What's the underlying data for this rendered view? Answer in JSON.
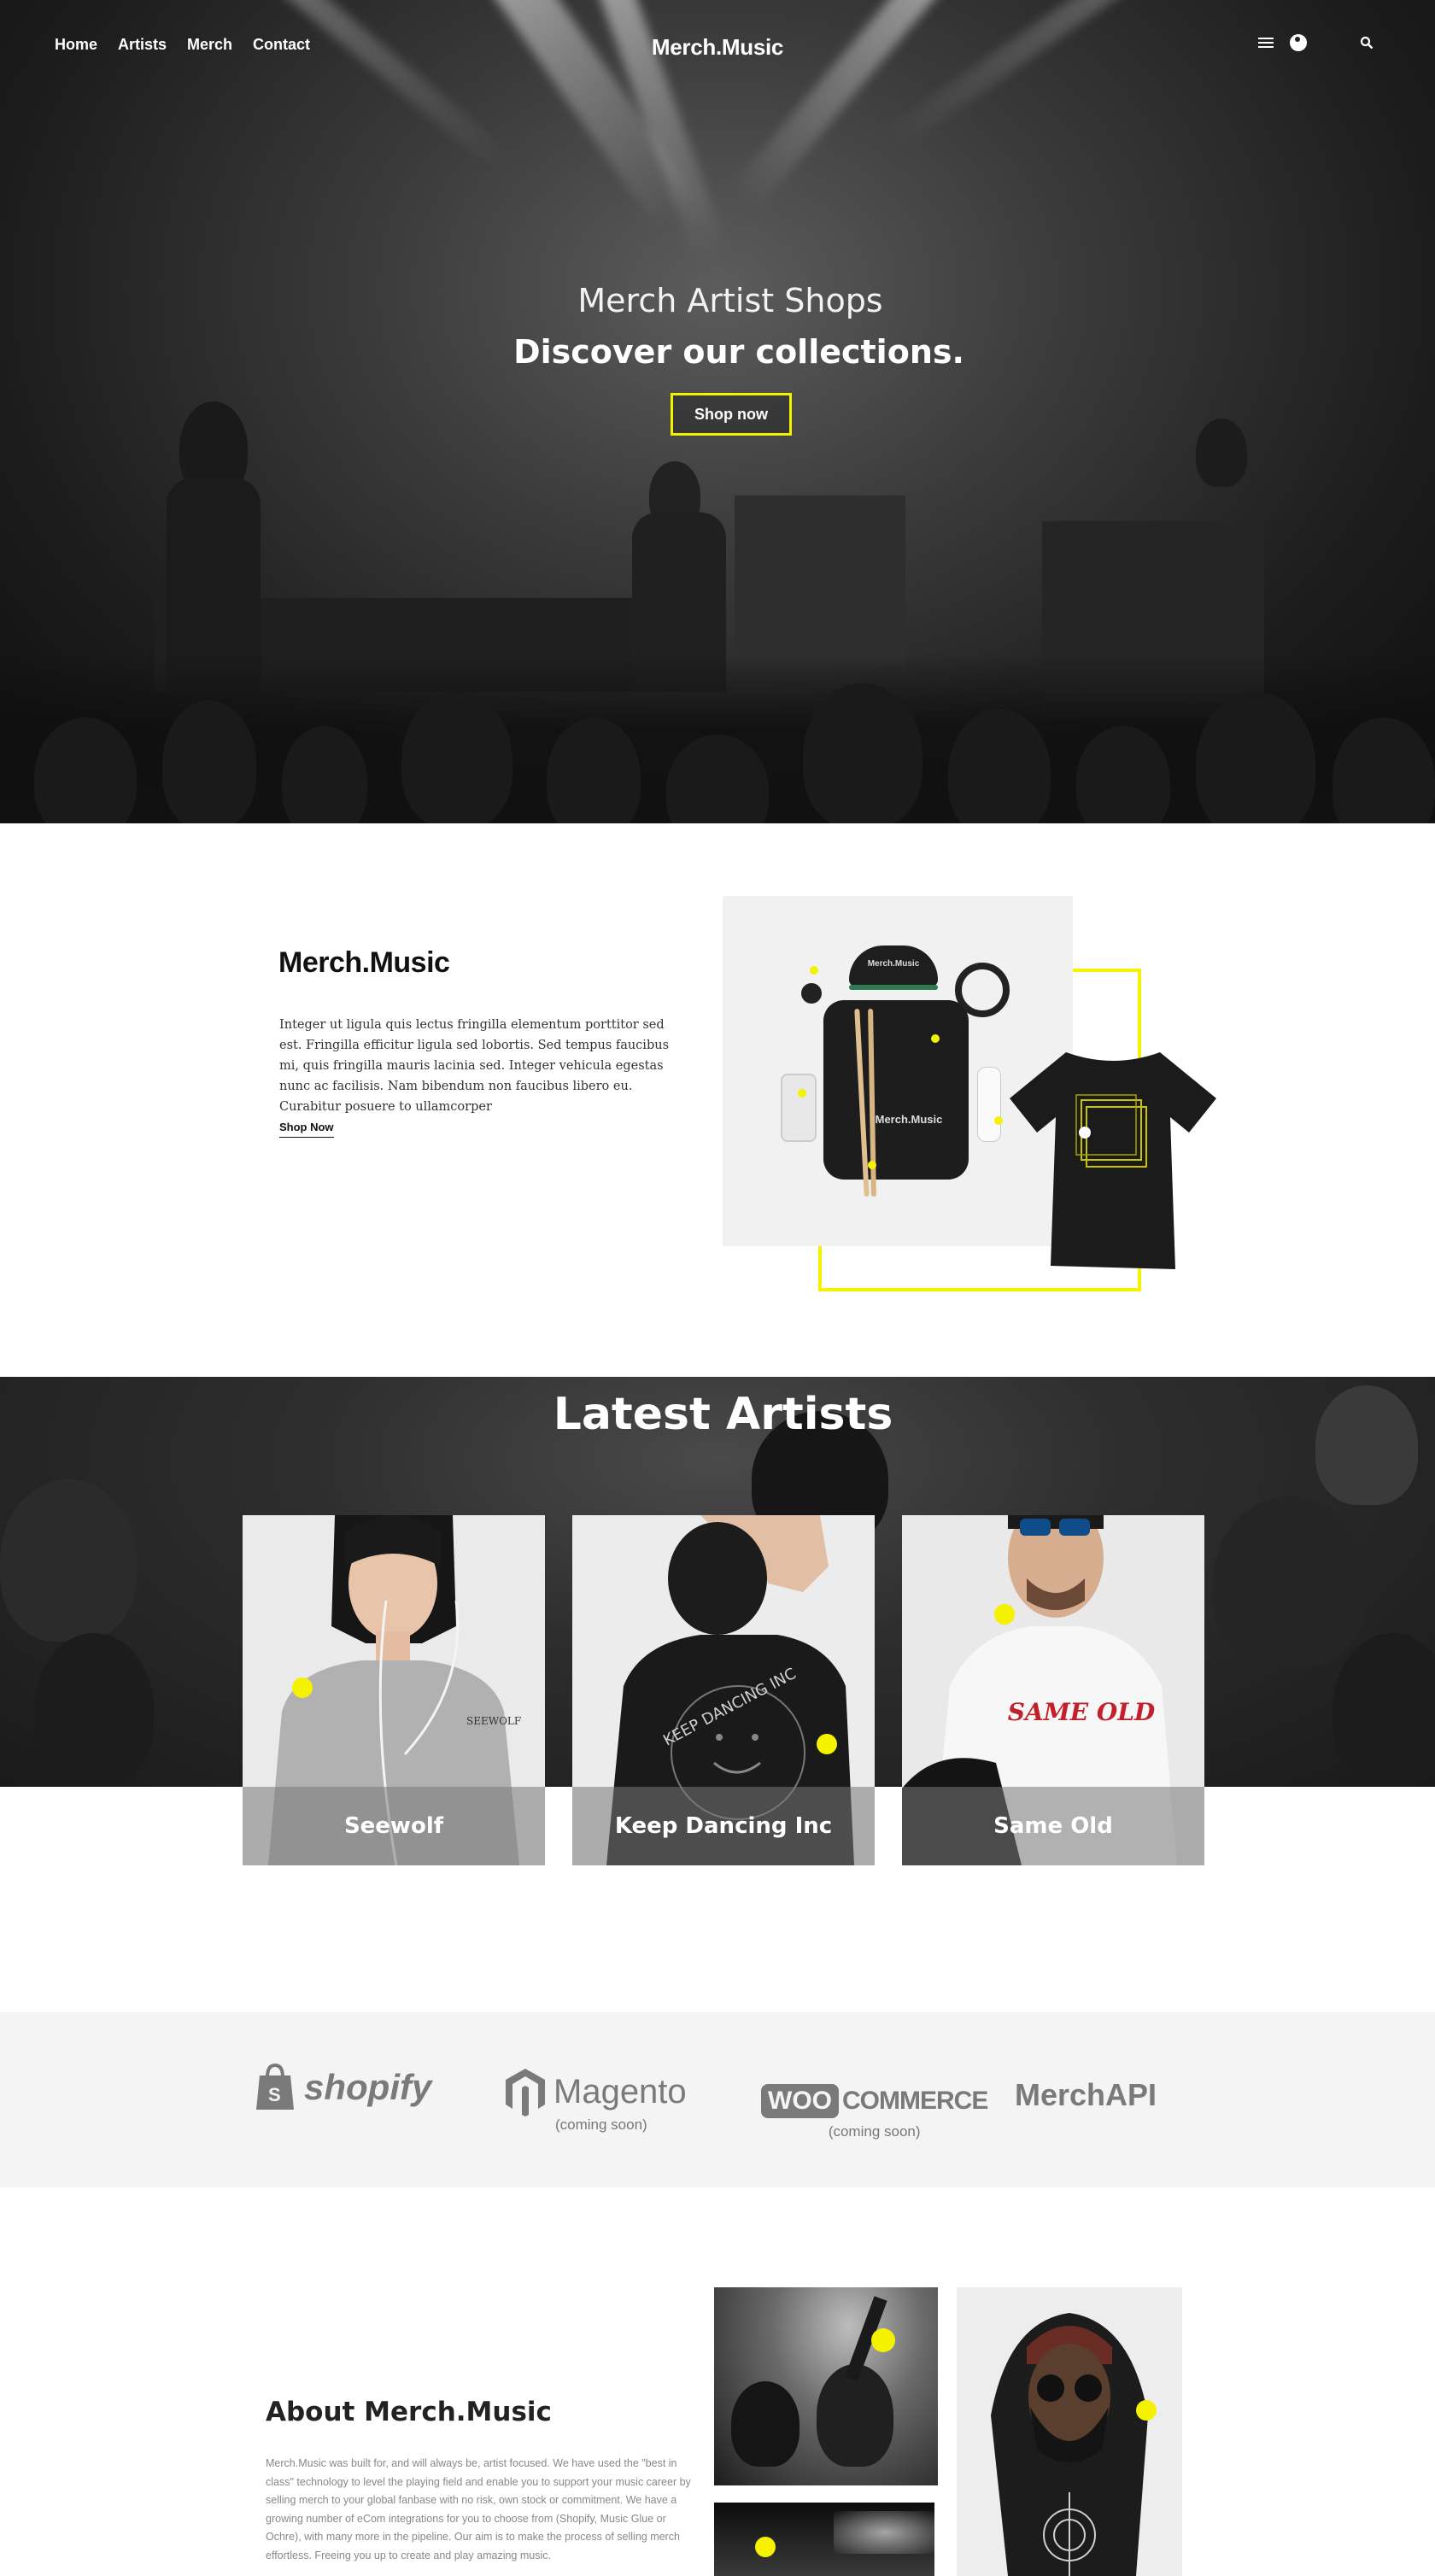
{
  "nav": {
    "items": [
      "Home",
      "Artists",
      "Merch",
      "Contact"
    ]
  },
  "brand": "Merch.Music",
  "header_icons": [
    "menu-icon",
    "user-icon",
    "search-icon"
  ],
  "hero": {
    "subtitle": "Merch Artist Shops",
    "title": "Discover our collections.",
    "cta": "Shop now"
  },
  "intro": {
    "logo": "Merch.Music",
    "text": "Integer ut ligula quis lectus fringilla elementum porttitor sed est. Fringilla efficitur ligula sed lobortis. Sed tempus faucibus mi, quis fringilla mauris lacinia sed. Integer vehicula egestas nunc ac facilisis. Nam bibendum non faucibus libero eu. Curabitur posuere to ullamcorper",
    "link": "Shop Now",
    "product_label": "Merch.Music"
  },
  "artists": {
    "title": "Latest Artists",
    "cards": [
      {
        "name": "Seewolf",
        "shirt_text": "SEEWOLF"
      },
      {
        "name": "Keep Dancing Inc",
        "shirt_text": "KEEP DANCING INC"
      },
      {
        "name": "Same Old",
        "shirt_text": "SAME OLD"
      }
    ]
  },
  "partners": [
    {
      "name": "shopify",
      "note": ""
    },
    {
      "name": "Magento",
      "note": "(coming soon)"
    },
    {
      "name": "COMMERCE",
      "prefix": "WOO",
      "note": "(coming soon)"
    },
    {
      "name": "MerchAPI",
      "note": ""
    }
  ],
  "about": {
    "title": "About Merch.Music",
    "text": "Merch.Music was built for, and will always be, artist focused. We have used the \"best in class\" technology to level the playing field and enable you to support your music career by selling merch to your global fanbase with no risk, own stock or commitment. We have a growing number of eCom integrations for you to choose from (Shopify, Music Glue or Ochre), with many more in the pipeline. Our aim is to make the process of selling merch effortless. Freeing you up to create and play amazing music."
  },
  "colors": {
    "accent": "#f5f200",
    "dark": "#111111",
    "partners_bg": "#f4f4f4"
  }
}
